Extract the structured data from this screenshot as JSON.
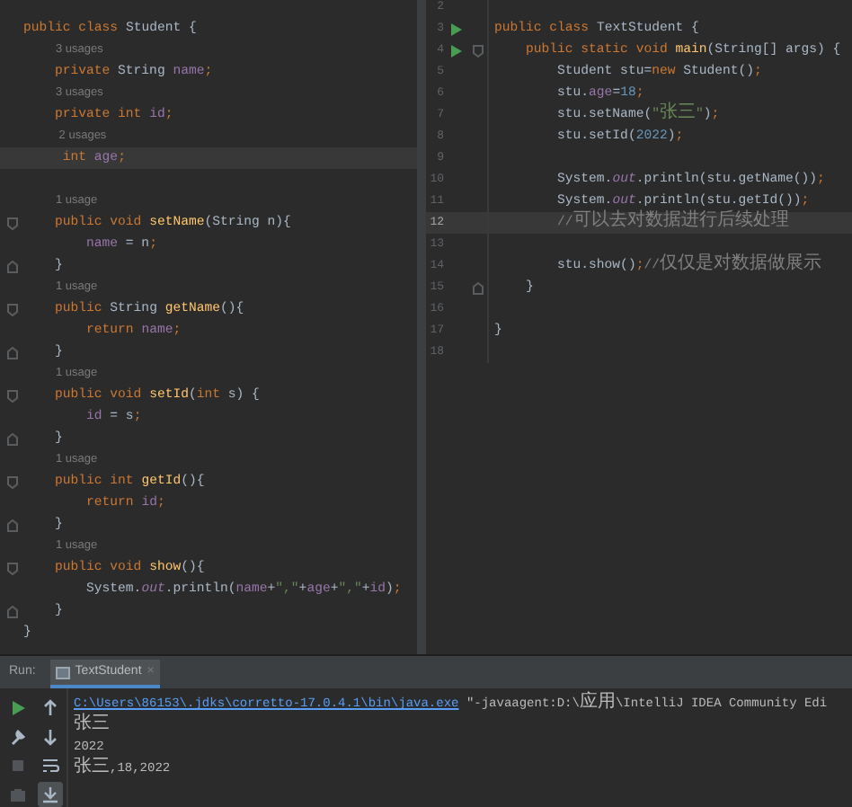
{
  "left_editor": {
    "lines": [
      {
        "kind": "code",
        "current": false,
        "tokens": [
          {
            "kind": "kw",
            "text": "public class "
          },
          {
            "kind": "plain",
            "text": "Student {"
          }
        ]
      },
      {
        "kind": "hint",
        "text": "3 usages"
      },
      {
        "kind": "code",
        "current": false,
        "tokens": [
          {
            "kind": "kw",
            "text": "    private "
          },
          {
            "kind": "plain",
            "text": "String "
          },
          {
            "kind": "field",
            "text": "name"
          },
          {
            "kind": "kw",
            "text": ";"
          }
        ]
      },
      {
        "kind": "hint",
        "text": "3 usages"
      },
      {
        "kind": "code",
        "current": false,
        "tokens": [
          {
            "kind": "kw",
            "text": "    private int "
          },
          {
            "kind": "field",
            "text": "id"
          },
          {
            "kind": "kw",
            "text": ";"
          }
        ]
      },
      {
        "kind": "hint",
        "text": " 2 usages"
      },
      {
        "kind": "code",
        "current": true,
        "tokens": [
          {
            "kind": "kw",
            "text": "     int "
          },
          {
            "kind": "field",
            "text": "age"
          },
          {
            "kind": "kw",
            "text": ";"
          }
        ]
      },
      {
        "kind": "blank",
        "current": false
      },
      {
        "kind": "hint",
        "text": "1 usage"
      },
      {
        "kind": "code",
        "current": false,
        "fold_start": true,
        "tokens": [
          {
            "kind": "kw",
            "text": "    public void "
          },
          {
            "kind": "method",
            "text": "setName"
          },
          {
            "kind": "plain",
            "text": "(String n){"
          }
        ]
      },
      {
        "kind": "code",
        "current": false,
        "tokens": [
          {
            "kind": "field",
            "text": "        name"
          },
          {
            "kind": "plain",
            "text": " = n"
          },
          {
            "kind": "kw",
            "text": ";"
          }
        ]
      },
      {
        "kind": "code",
        "current": false,
        "fold_end": true,
        "tokens": [
          {
            "kind": "plain",
            "text": "    }"
          }
        ]
      },
      {
        "kind": "hint",
        "text": "1 usage"
      },
      {
        "kind": "code",
        "current": false,
        "fold_start": true,
        "tokens": [
          {
            "kind": "kw",
            "text": "    public "
          },
          {
            "kind": "plain",
            "text": "String "
          },
          {
            "kind": "method",
            "text": "getName"
          },
          {
            "kind": "plain",
            "text": "(){"
          }
        ]
      },
      {
        "kind": "code",
        "current": false,
        "tokens": [
          {
            "kind": "kw",
            "text": "        return "
          },
          {
            "kind": "field",
            "text": "name"
          },
          {
            "kind": "kw",
            "text": ";"
          }
        ]
      },
      {
        "kind": "code",
        "current": false,
        "fold_end": true,
        "tokens": [
          {
            "kind": "plain",
            "text": "    }"
          }
        ]
      },
      {
        "kind": "hint",
        "text": "1 usage"
      },
      {
        "kind": "code",
        "current": false,
        "fold_start": true,
        "tokens": [
          {
            "kind": "kw",
            "text": "    public void "
          },
          {
            "kind": "method",
            "text": "setId"
          },
          {
            "kind": "plain",
            "text": "("
          },
          {
            "kind": "kw",
            "text": "int "
          },
          {
            "kind": "plain",
            "text": "s) {"
          }
        ]
      },
      {
        "kind": "code",
        "current": false,
        "tokens": [
          {
            "kind": "field",
            "text": "        id"
          },
          {
            "kind": "plain",
            "text": " = s"
          },
          {
            "kind": "kw",
            "text": ";"
          }
        ]
      },
      {
        "kind": "code",
        "current": false,
        "fold_end": true,
        "tokens": [
          {
            "kind": "plain",
            "text": "    }"
          }
        ]
      },
      {
        "kind": "hint",
        "text": "1 usage"
      },
      {
        "kind": "code",
        "current": false,
        "fold_start": true,
        "tokens": [
          {
            "kind": "kw",
            "text": "    public int "
          },
          {
            "kind": "method",
            "text": "getId"
          },
          {
            "kind": "plain",
            "text": "(){"
          }
        ]
      },
      {
        "kind": "code",
        "current": false,
        "tokens": [
          {
            "kind": "kw",
            "text": "        return "
          },
          {
            "kind": "field",
            "text": "id"
          },
          {
            "kind": "kw",
            "text": ";"
          }
        ]
      },
      {
        "kind": "code",
        "current": false,
        "fold_end": true,
        "tokens": [
          {
            "kind": "plain",
            "text": "    }"
          }
        ]
      },
      {
        "kind": "hint",
        "text": "1 usage"
      },
      {
        "kind": "code",
        "current": false,
        "fold_start": true,
        "tokens": [
          {
            "kind": "kw",
            "text": "    public void "
          },
          {
            "kind": "method",
            "text": "show"
          },
          {
            "kind": "plain",
            "text": "(){"
          }
        ]
      },
      {
        "kind": "code",
        "current": false,
        "tokens": [
          {
            "kind": "plain",
            "text": "        System."
          },
          {
            "kind": "static",
            "text": "out"
          },
          {
            "kind": "plain",
            "text": ".println("
          },
          {
            "kind": "field",
            "text": "name"
          },
          {
            "kind": "plain",
            "text": "+"
          },
          {
            "kind": "string",
            "text": "\",\""
          },
          {
            "kind": "plain",
            "text": "+"
          },
          {
            "kind": "field",
            "text": "age"
          },
          {
            "kind": "plain",
            "text": "+"
          },
          {
            "kind": "string",
            "text": "\",\""
          },
          {
            "kind": "plain",
            "text": "+"
          },
          {
            "kind": "field",
            "text": "id"
          },
          {
            "kind": "plain",
            "text": ")"
          },
          {
            "kind": "kw",
            "text": ";"
          }
        ]
      },
      {
        "kind": "code",
        "current": false,
        "fold_end": true,
        "tokens": [
          {
            "kind": "plain",
            "text": "    }"
          }
        ]
      },
      {
        "kind": "code",
        "current": false,
        "tokens": [
          {
            "kind": "plain",
            "text": "}"
          }
        ]
      }
    ]
  },
  "right_editor": {
    "lines": [
      {
        "number": "2",
        "current": false
      },
      {
        "number": "3",
        "current": false,
        "run": true,
        "tokens": [
          {
            "kind": "kw",
            "text": "public class "
          },
          {
            "kind": "plain",
            "text": "TextStudent {"
          }
        ]
      },
      {
        "number": "4",
        "current": false,
        "run": true,
        "fold_start": true,
        "tokens": [
          {
            "kind": "kw",
            "text": "    public static void "
          },
          {
            "kind": "method",
            "text": "main"
          },
          {
            "kind": "plain",
            "text": "(String[] args) {"
          }
        ]
      },
      {
        "number": "5",
        "current": false,
        "tokens": [
          {
            "kind": "plain",
            "text": "        Student stu="
          },
          {
            "kind": "kw",
            "text": "new "
          },
          {
            "kind": "plain",
            "text": "Student()"
          },
          {
            "kind": "kw",
            "text": ";"
          }
        ]
      },
      {
        "number": "6",
        "current": false,
        "tokens": [
          {
            "kind": "plain",
            "text": "        stu."
          },
          {
            "kind": "field",
            "text": "age"
          },
          {
            "kind": "plain",
            "text": "="
          },
          {
            "kind": "number",
            "text": "18"
          },
          {
            "kind": "kw",
            "text": ";"
          }
        ]
      },
      {
        "number": "7",
        "current": false,
        "tokens": [
          {
            "kind": "plain",
            "text": "        stu.setName("
          },
          {
            "kind": "string",
            "text": "\"张三\""
          },
          {
            "kind": "plain",
            "text": ")"
          },
          {
            "kind": "kw",
            "text": ";"
          }
        ]
      },
      {
        "number": "8",
        "current": false,
        "tokens": [
          {
            "kind": "plain",
            "text": "        stu.setId("
          },
          {
            "kind": "number",
            "text": "2022"
          },
          {
            "kind": "plain",
            "text": ")"
          },
          {
            "kind": "kw",
            "text": ";"
          }
        ]
      },
      {
        "number": "9",
        "current": false
      },
      {
        "number": "10",
        "current": false,
        "tokens": [
          {
            "kind": "plain",
            "text": "        System."
          },
          {
            "kind": "static",
            "text": "out"
          },
          {
            "kind": "plain",
            "text": ".println(stu.getName())"
          },
          {
            "kind": "kw",
            "text": ";"
          }
        ]
      },
      {
        "number": "11",
        "current": false,
        "tokens": [
          {
            "kind": "plain",
            "text": "        System."
          },
          {
            "kind": "static",
            "text": "out"
          },
          {
            "kind": "plain",
            "text": ".println(stu.getId())"
          },
          {
            "kind": "kw",
            "text": ";"
          }
        ]
      },
      {
        "number": "12",
        "current": true,
        "tokens": [
          {
            "kind": "comment",
            "text": "        //可以去对数据进行后续处理"
          }
        ]
      },
      {
        "number": "13",
        "current": false
      },
      {
        "number": "14",
        "current": false,
        "tokens": [
          {
            "kind": "plain",
            "text": "        stu.show()"
          },
          {
            "kind": "kw",
            "text": ";"
          },
          {
            "kind": "comment",
            "text": "//仅仅是对数据做展示"
          }
        ]
      },
      {
        "number": "15",
        "current": false,
        "fold_end": true,
        "tokens": [
          {
            "kind": "plain",
            "text": "    }"
          }
        ]
      },
      {
        "number": "16",
        "current": false
      },
      {
        "number": "17",
        "current": false,
        "tokens": [
          {
            "kind": "plain",
            "text": "}"
          }
        ]
      },
      {
        "number": "18",
        "current": false
      }
    ]
  },
  "run_panel": {
    "label": "Run:",
    "tab": {
      "label": "TextStudent",
      "selected": true,
      "close": "×"
    },
    "toolbar": [
      {
        "disabled": false,
        "selected": false
      },
      {
        "disabled": false,
        "selected": false
      },
      {
        "disabled": false,
        "selected": false
      },
      {
        "disabled": false,
        "selected": false
      },
      {
        "disabled": true,
        "selected": false
      },
      {
        "disabled": false,
        "selected": false
      },
      {
        "disabled": true,
        "selected": false
      },
      {
        "disabled": false,
        "selected": true
      }
    ],
    "output": [
      {
        "kind": "command",
        "link": "C:\\Users\\86153\\.jdks\\corretto-17.0.4.1\\bin\\java.exe",
        "text": " \"-javaagent:D:\\应用\\IntelliJ IDEA Community Edi"
      },
      {
        "kind": "stdout",
        "text": "张三"
      },
      {
        "kind": "stdout",
        "text": "2022"
      },
      {
        "kind": "stdout",
        "text": "张三,18,2022"
      }
    ]
  }
}
